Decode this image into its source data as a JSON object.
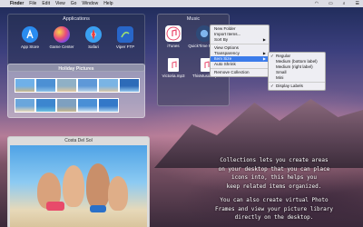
{
  "menubar": {
    "app_name": "Finder",
    "items": [
      "File",
      "Edit",
      "View",
      "Go",
      "Window",
      "Help"
    ],
    "status_icons": [
      "wifi-icon",
      "battery-icon",
      "search-icon",
      "list-icon"
    ]
  },
  "applications": {
    "title": "Applications",
    "items": [
      {
        "label": "App Store",
        "icon": "app-store-icon",
        "color": "#2a8cf0"
      },
      {
        "label": "Game Center",
        "icon": "game-center-icon",
        "color": "#e84a7a"
      },
      {
        "label": "Safari",
        "icon": "safari-icon",
        "color": "#3aa0f2"
      },
      {
        "label": "Viper FTP",
        "icon": "viper-ftp-icon",
        "color": "#2866c8"
      }
    ]
  },
  "holiday": {
    "title": "Holiday Pictures",
    "thumbnails": [
      {
        "colors": [
          "#6fb0e8",
          "#c9b68a"
        ]
      },
      {
        "colors": [
          "#4c90d4",
          "#8bbfe6"
        ]
      },
      {
        "colors": [
          "#8fb0c6",
          "#e0c9a0"
        ]
      },
      {
        "colors": [
          "#5e98d8",
          "#bcd4e8"
        ]
      },
      {
        "colors": [
          "#7ab4e4",
          "#d8c6a8"
        ]
      },
      {
        "colors": [
          "#2d6bb8",
          "#93c6ec"
        ]
      },
      {
        "colors": [
          "#6aa6dc",
          "#e8d8b8"
        ]
      },
      {
        "colors": [
          "#3c86cf",
          "#6dc0e0"
        ]
      },
      {
        "colors": [
          "#7ea0c0",
          "#c8b890"
        ]
      },
      {
        "colors": [
          "#4a8fd6",
          "#cfe3f2"
        ]
      },
      {
        "colors": [
          "#3378c8",
          "#a8d0ee"
        ]
      }
    ]
  },
  "costa": {
    "title": "Costa Del Sol"
  },
  "music": {
    "title": "Music",
    "items": [
      {
        "label": "iTunes",
        "icon": "itunes-icon",
        "color": "#e8456a"
      },
      {
        "label": "QuickTime Player",
        "icon": "quicktime-icon",
        "color": "#2e4a78"
      },
      {
        "label": "Victoria.mp3",
        "icon": "mp3-file-icon",
        "color": "#ffffff"
      },
      {
        "label": "ThisMusic.mp3",
        "icon": "mp3-file-icon",
        "color": "#ffffff"
      }
    ]
  },
  "context_menu": {
    "items": [
      {
        "label": "New Folder",
        "submenu": false
      },
      {
        "label": "Import Items...",
        "submenu": false
      },
      {
        "label": "Sort By",
        "submenu": true
      },
      {
        "label": "View Options",
        "submenu": false,
        "separator_before": true
      },
      {
        "label": "Transparency",
        "submenu": true
      },
      {
        "label": "Item Size",
        "submenu": true,
        "selected": true
      },
      {
        "label": "Auto Shrink",
        "submenu": false
      },
      {
        "label": "Remove Collection",
        "submenu": false,
        "separator_before": true
      }
    ]
  },
  "submenu": {
    "items": [
      {
        "label": "Regular",
        "checked": true
      },
      {
        "label": "Medium (bottom label)",
        "checked": false
      },
      {
        "label": "Medium (right label)",
        "checked": false
      },
      {
        "label": "Small",
        "checked": false
      },
      {
        "label": "Mini",
        "checked": false
      },
      {
        "label": "Display Labels",
        "checked": true,
        "separator_before": true
      }
    ]
  },
  "caption": {
    "paragraph1": [
      "Collections lets you create areas",
      "on your desktop that you can place",
      "icons into, this helps you",
      "keep related items organized."
    ],
    "paragraph2": [
      "You can also create virtual Photo",
      "Frames and view your picture library",
      "directly on the desktop."
    ]
  },
  "colors": {
    "menu_highlight": "#3b7bea"
  }
}
